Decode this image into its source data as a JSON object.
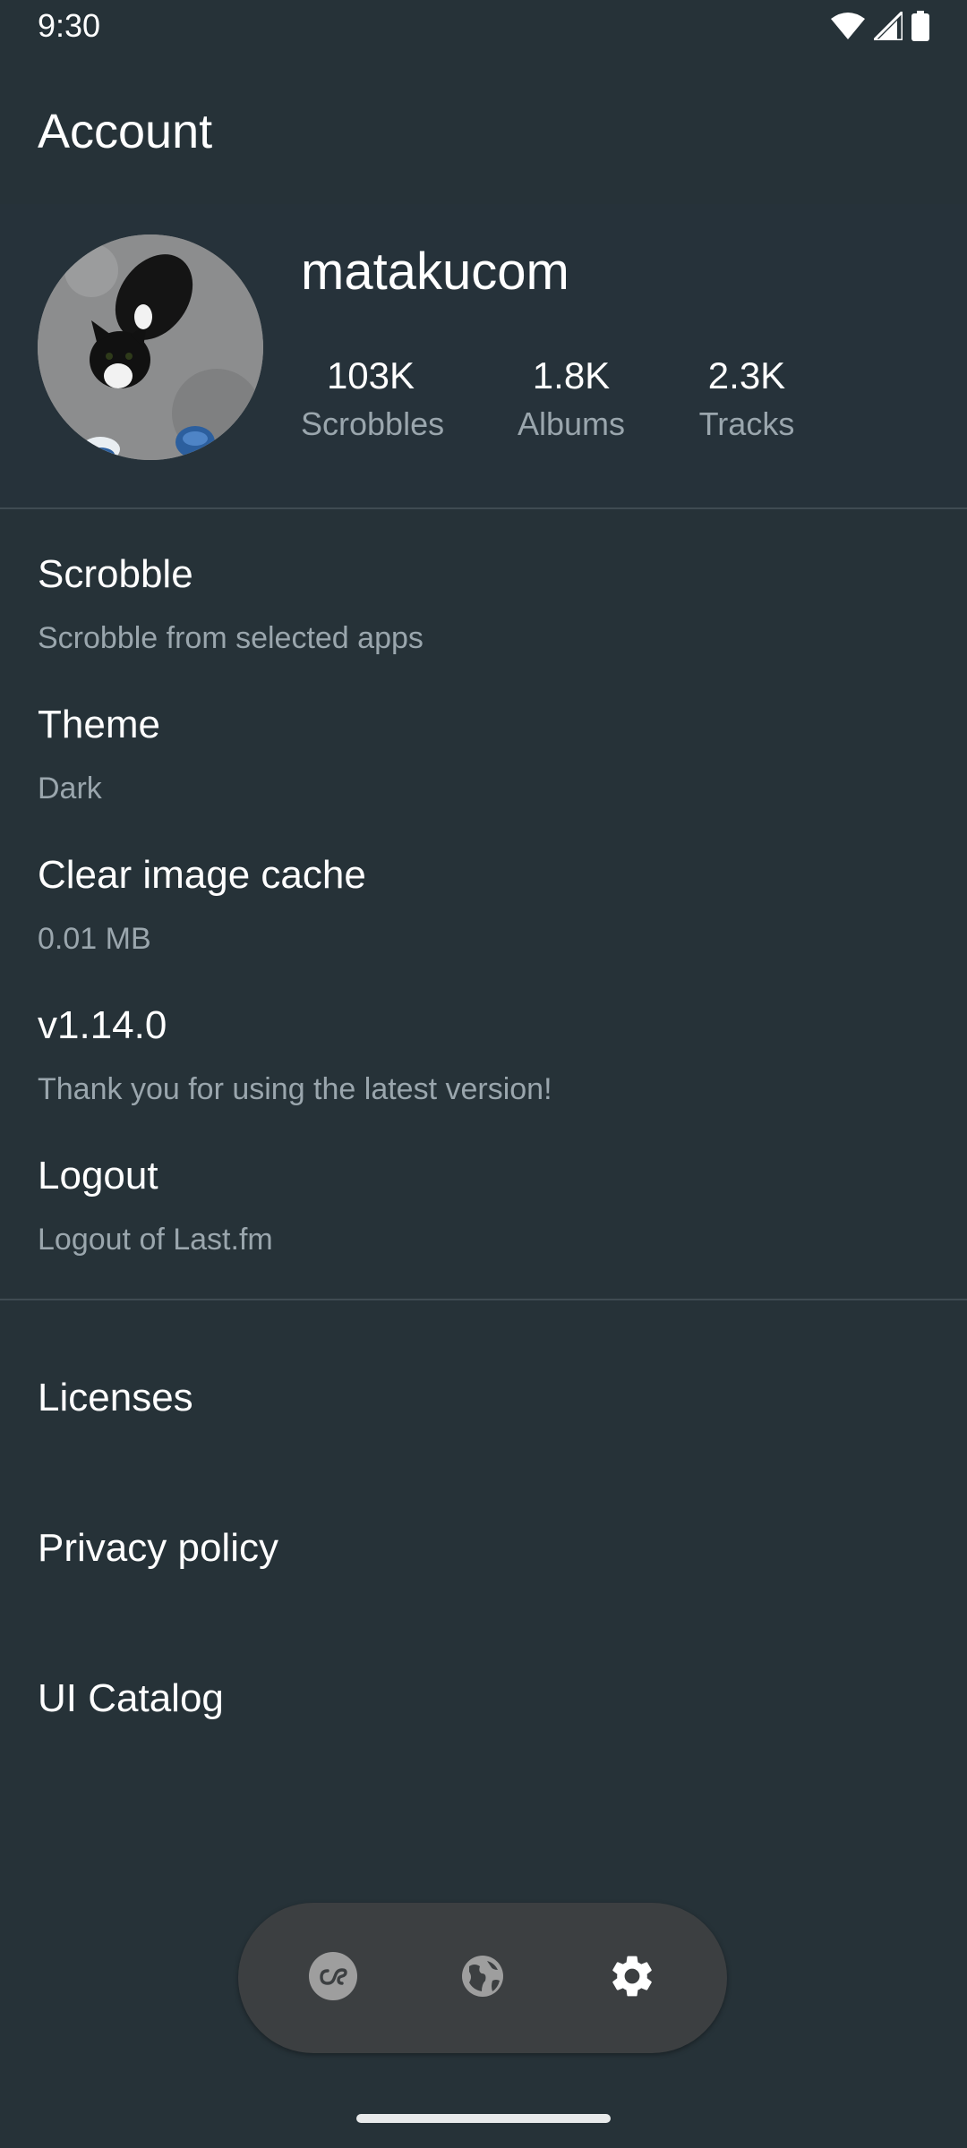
{
  "status_bar": {
    "time": "9:30"
  },
  "app_bar": {
    "title": "Account"
  },
  "profile": {
    "username": "matakucom",
    "stats": [
      {
        "value": "103K",
        "label": "Scrobbles"
      },
      {
        "value": "1.8K",
        "label": "Albums"
      },
      {
        "value": "2.3K",
        "label": "Tracks"
      }
    ]
  },
  "settings": [
    {
      "title": "Scrobble",
      "subtitle": "Scrobble from selected apps"
    },
    {
      "title": "Theme",
      "subtitle": "Dark"
    },
    {
      "title": "Clear image cache",
      "subtitle": "0.01 MB"
    },
    {
      "title": "v1.14.0",
      "subtitle": "Thank you for using the latest version!"
    },
    {
      "title": "Logout",
      "subtitle": "Logout of Last.fm"
    }
  ],
  "links": [
    {
      "label": "Licenses"
    },
    {
      "label": "Privacy policy"
    },
    {
      "label": "UI Catalog"
    }
  ],
  "bottom_nav": {
    "items": [
      {
        "icon": "lastfm-icon",
        "active": false
      },
      {
        "icon": "globe-icon",
        "active": false
      },
      {
        "icon": "gear-icon",
        "active": true
      }
    ]
  },
  "colors": {
    "background": "#263238",
    "secondary_text": "#9aa6ad",
    "nav_background": "#3c3f41",
    "divider": "#3f4b52"
  }
}
